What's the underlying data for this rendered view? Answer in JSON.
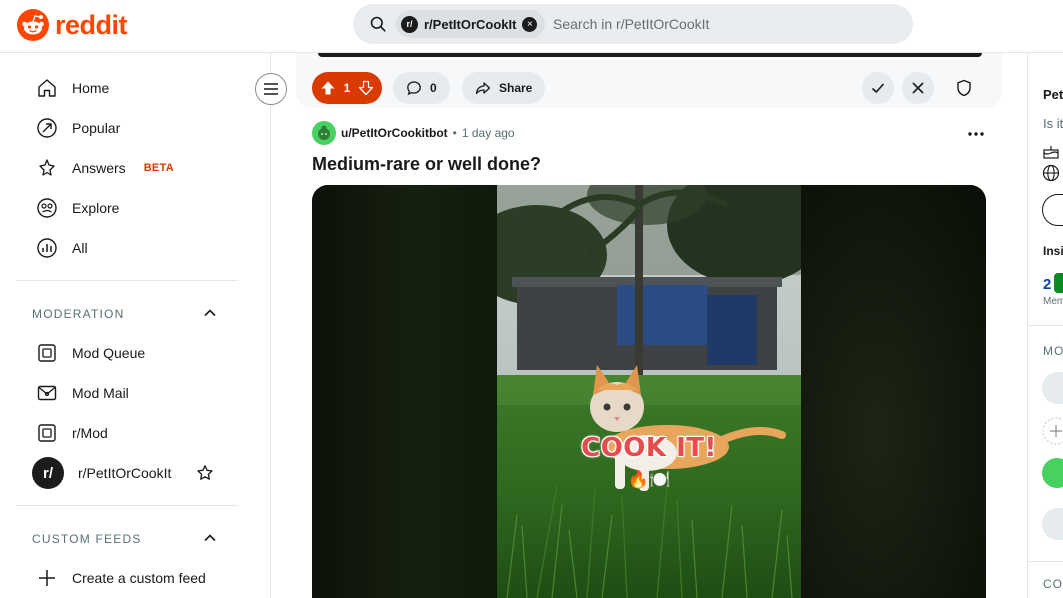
{
  "header": {
    "logo_text": "reddit",
    "search_chip_avatar": "r/",
    "search_chip_label": "r/PetItOrCookIt",
    "search_chip_close": "×",
    "search_placeholder": "Search in r/PetItOrCookIt",
    "brand_color": "#ff4500"
  },
  "sidebar": {
    "nav": [
      {
        "label": "Home",
        "icon": "home-icon"
      },
      {
        "label": "Popular",
        "icon": "popular-icon"
      },
      {
        "label": "Answers",
        "badge": "BETA",
        "icon": "answers-icon"
      },
      {
        "label": "Explore",
        "icon": "explore-icon"
      },
      {
        "label": "All",
        "icon": "all-icon"
      }
    ],
    "moderation_title": "MODERATION",
    "moderation": [
      {
        "label": "Mod Queue",
        "icon": "mod-queue-icon"
      },
      {
        "label": "Mod Mail",
        "icon": "mod-mail-icon"
      },
      {
        "label": "r/Mod",
        "icon": "mod-icon"
      },
      {
        "label": "r/PetItOrCookIt",
        "avatar": "r/"
      }
    ],
    "custom_feeds_title": "CUSTOM FEEDS",
    "create_feed_label": "Create a custom feed"
  },
  "prev_post": {
    "vote_count": "1",
    "comment_count": "0",
    "share_label": "Share",
    "upvoted_color": "#d93a00"
  },
  "post": {
    "author": "u/PetItOrCookitbot",
    "separator": "•",
    "time": "1 day ago",
    "title": "Medium-rare or well done?",
    "overlay_text": "COOK IT!",
    "overlay_emoji": "🔥🍽️"
  },
  "rail": {
    "title_fragment": "Pet",
    "desc_fragment": "Is it",
    "insights_fragment": "Insi",
    "members_count_fragment": "2",
    "members_label_fragment": "Mem",
    "mod_fragment": "MO",
    "com_fragment": "COM"
  }
}
